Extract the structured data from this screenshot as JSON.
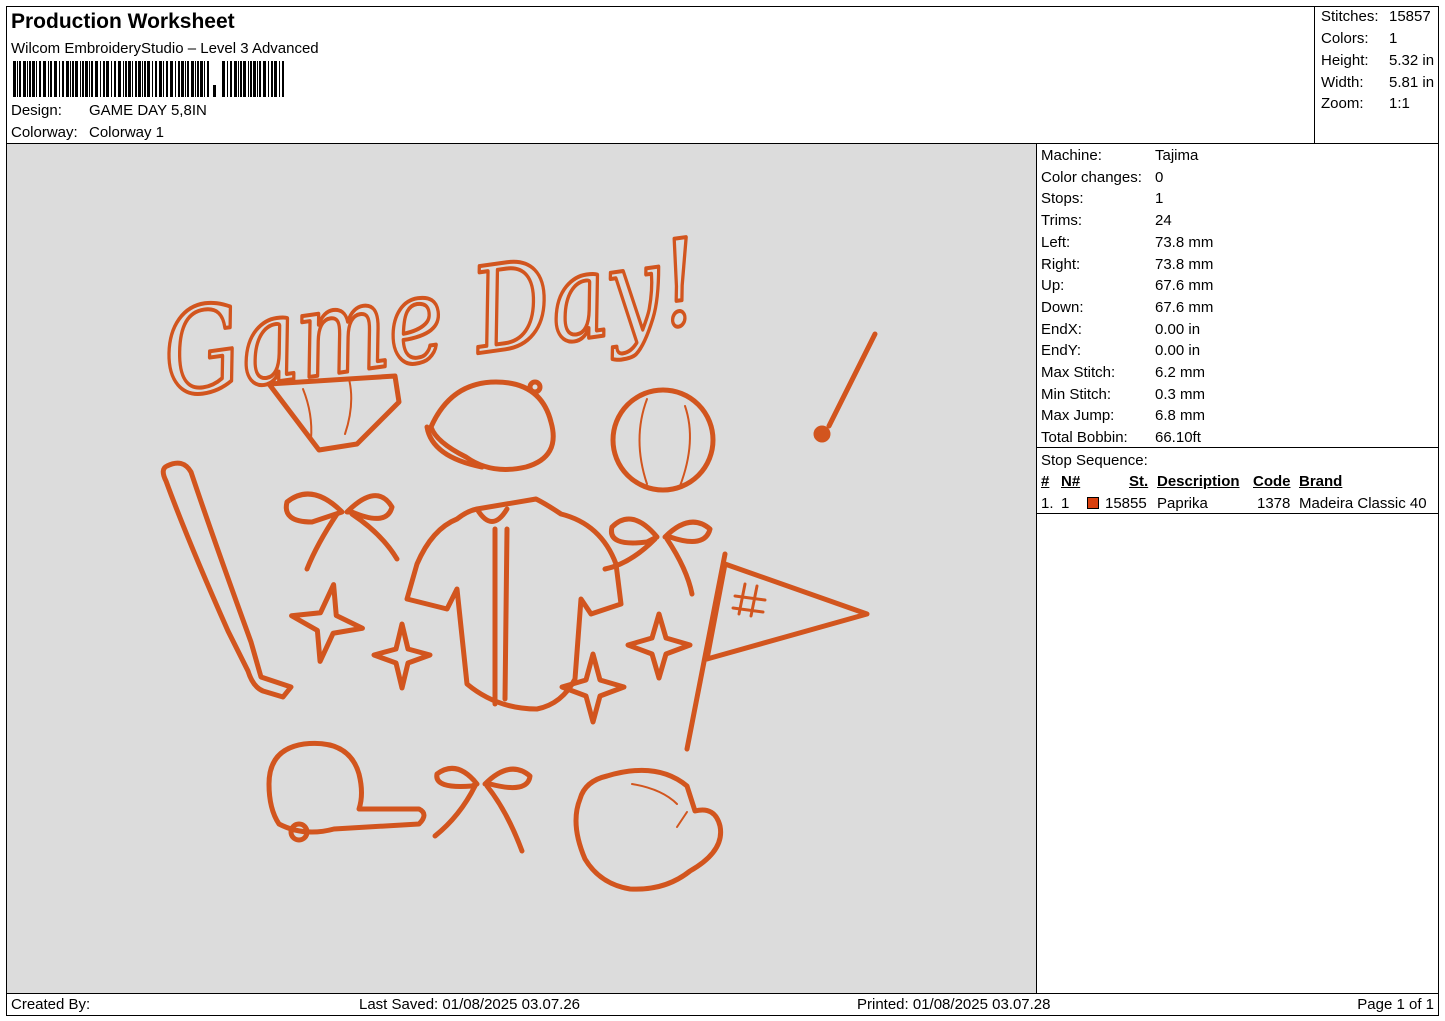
{
  "header": {
    "title": "Production Worksheet",
    "subtitle": "Wilcom EmbroideryStudio – Level 3 Advanced",
    "design_label": "Design:",
    "design_value": "GAME DAY 5,8IN",
    "colorway_label": "Colorway:",
    "colorway_value": "Colorway 1"
  },
  "stats": [
    {
      "label": "Stitches:",
      "value": "15857"
    },
    {
      "label": "Colors:",
      "value": "1"
    },
    {
      "label": "Height:",
      "value": "5.32 in"
    },
    {
      "label": "Width:",
      "value": "5.81 in"
    },
    {
      "label": "Zoom:",
      "value": "1:1"
    }
  ],
  "machine_info": [
    {
      "label": "Machine:",
      "value": "Tajima"
    },
    {
      "label": "Color changes:",
      "value": "0"
    },
    {
      "label": "Stops:",
      "value": "1"
    },
    {
      "label": "Trims:",
      "value": "24"
    },
    {
      "label": "Left:",
      "value": "73.8 mm"
    },
    {
      "label": "Right:",
      "value": "73.8 mm"
    },
    {
      "label": "Up:",
      "value": "67.6 mm"
    },
    {
      "label": "Down:",
      "value": "67.6 mm"
    },
    {
      "label": "EndX:",
      "value": "0.00 in"
    },
    {
      "label": "EndY:",
      "value": "0.00 in"
    },
    {
      "label": "Max Stitch:",
      "value": "6.2 mm"
    },
    {
      "label": "Min Stitch:",
      "value": "0.3 mm"
    },
    {
      "label": "Max Jump:",
      "value": "6.8 mm"
    },
    {
      "label": "Total Bobbin:",
      "value": "66.10ft"
    }
  ],
  "stop_sequence": {
    "title": "Stop Sequence:",
    "columns": [
      "#",
      "N#",
      "St.",
      "Description",
      "Code",
      "Brand"
    ],
    "rows": [
      {
        "index": "1.",
        "needle": "1",
        "stitches": "15855",
        "description": "Paprika",
        "code": "1378",
        "brand": "Madeira Classic 40",
        "color": "#d9400e"
      }
    ]
  },
  "design_preview": {
    "text": "Game Day!",
    "thread_color": "#d2551e",
    "background": "#dcdcdc"
  },
  "footer": {
    "created_by": "Created By:",
    "last_saved": "Last Saved: 01/08/2025 03.07.26",
    "printed": "Printed: 01/08/2025 03.07.28",
    "page": "Page 1 of 1"
  }
}
